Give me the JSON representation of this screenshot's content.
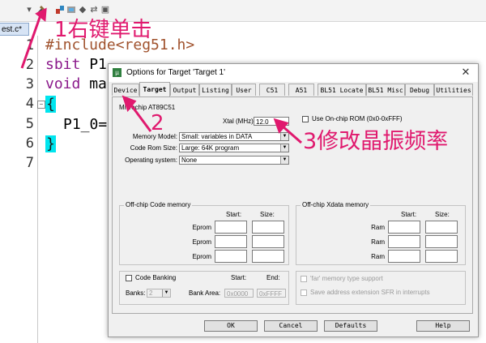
{
  "editor": {
    "file_tab": "est.c*",
    "line_numbers": [
      "1",
      "2",
      "3",
      "4",
      "5",
      "6",
      "7"
    ],
    "lines": {
      "l1": "#include<reg51.h>",
      "l2_kw": "sbit",
      "l2_rest": " P1",
      "l3_kw": "void",
      "l3_rest": " ma",
      "l4": "{",
      "l5": "P1_0=",
      "l6": "}"
    },
    "fold_marker": "−"
  },
  "annotations": {
    "step1": "1右键单击",
    "step2": "2",
    "step3": "3修改晶振频率",
    "color": "#e0196e"
  },
  "dialog": {
    "title": "Options for Target 'Target 1'",
    "close": "✕",
    "tabs": [
      "Device",
      "Target",
      "Output",
      "Listing",
      "User",
      "C51",
      "A51",
      "BL51 Locate",
      "BL51 Misc",
      "Debug",
      "Utilities"
    ],
    "active_tab": "Target",
    "device": "Microchip AT89C51",
    "xtal_label": "Xtal (MHz):",
    "xtal_value": "12.0",
    "use_onchip_rom": "Use On-chip ROM (0x0-0xFFF)",
    "memory_model_label": "Memory Model:",
    "memory_model_value": "Small: variables in DATA",
    "code_rom_size_label": "Code Rom Size:",
    "code_rom_size_value": "Large: 64K program",
    "os_label": "Operating system:",
    "os_value": "None",
    "offchip_code": {
      "title": "Off-chip Code memory",
      "start": "Start:",
      "size": "Size:",
      "rows": [
        "Eprom",
        "Eprom",
        "Eprom"
      ]
    },
    "offchip_xdata": {
      "title": "Off-chip Xdata memory",
      "start": "Start:",
      "size": "Size:",
      "rows": [
        "Ram",
        "Ram",
        "Ram"
      ]
    },
    "code_banking": "Code Banking",
    "cb_start": "Start:",
    "cb_end": "End:",
    "banks_label": "Banks:",
    "banks_value": "2",
    "bank_area_label": "Bank Area:",
    "bank_area_start": "0x0000",
    "bank_area_end": "0xFFFF",
    "far_memory": "'far' memory type support",
    "save_sfr": "Save address extension SFR in interrupts",
    "buttons": {
      "ok": "OK",
      "cancel": "Cancel",
      "defaults": "Defaults",
      "help": "Help"
    }
  }
}
